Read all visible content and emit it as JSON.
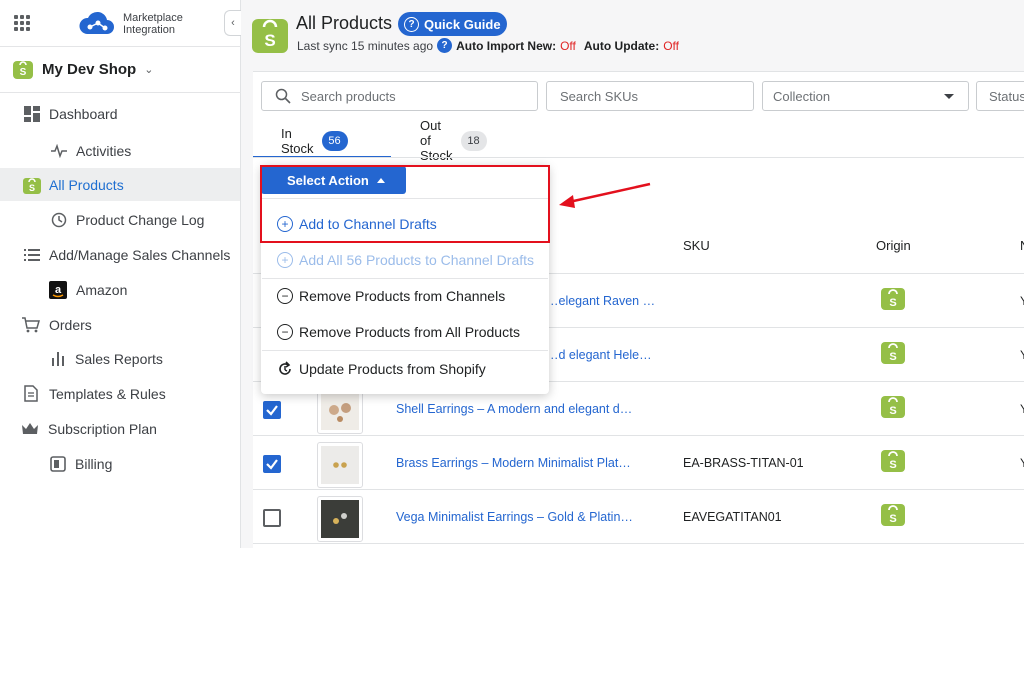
{
  "app": {
    "brand_line1": "Marketplace",
    "brand_line2": "Integration",
    "collapse_glyph": "‹",
    "shop_name": "My Dev Shop",
    "shop_caret": "⌄"
  },
  "sidebar": {
    "items": [
      {
        "label": "Dashboard",
        "icon": "dashboard-icon"
      },
      {
        "label": "Activities",
        "icon": "pulse-icon"
      },
      {
        "label": "All Products",
        "icon": "shopify-bag-icon",
        "active": true
      },
      {
        "label": "Product Change Log",
        "icon": "history-icon"
      },
      {
        "label": "Add/Manage Sales Channels",
        "icon": "list-icon"
      },
      {
        "label": "Amazon",
        "icon": "amazon-icon"
      },
      {
        "label": "Orders",
        "icon": "cart-icon"
      },
      {
        "label": "Sales Reports",
        "icon": "bar-chart-icon"
      },
      {
        "label": "Templates & Rules",
        "icon": "document-icon"
      },
      {
        "label": "Subscription Plan",
        "icon": "crown-icon"
      },
      {
        "label": "Billing",
        "icon": "billing-icon"
      }
    ]
  },
  "header": {
    "title": "All Products",
    "quick_guide": "Quick Guide",
    "last_sync": "Last sync 15 minutes ago",
    "auto_import_label": "Auto Import New:",
    "auto_import_value": "Off",
    "auto_update_label": "Auto Update:",
    "auto_update_value": "Off"
  },
  "filters": {
    "search_products": "Search products",
    "search_skus": "Search SKUs",
    "collection": "Collection",
    "status": "Status"
  },
  "tabs": [
    {
      "label": "In Stock",
      "count": "56"
    },
    {
      "label": "Out of Stock",
      "count": "18"
    }
  ],
  "table": {
    "col_sku": "SKU",
    "col_origin": "Origin",
    "col_cut": "N",
    "rows": [
      {
        "name": "…elegant Raven …",
        "sku": "",
        "checked": null
      },
      {
        "name": "…d elegant Hele…",
        "sku": "",
        "checked": null
      },
      {
        "name": "Shell Earrings – A modern and elegant d…",
        "sku": "",
        "checked": true
      },
      {
        "name": "Brass Earrings – Modern Minimalist Plat…",
        "sku": "EA-BRASS-TITAN-01",
        "checked": true
      },
      {
        "name": "Vega Minimalist Earrings – Gold & Platin…",
        "sku": "EAVEGATITAN01",
        "checked": false
      }
    ]
  },
  "menu": {
    "select_action": "Select Action",
    "add_to_drafts": "Add to Channel Drafts",
    "add_all": "Add All 56 Products to Channel Drafts",
    "remove_channels": "Remove Products from Channels",
    "remove_all": "Remove Products from All Products",
    "update_shopify": "Update Products from Shopify"
  },
  "colors": {
    "accent": "#2466d0",
    "shopify_green": "#95bf47",
    "annotation_red": "#e3101d"
  }
}
